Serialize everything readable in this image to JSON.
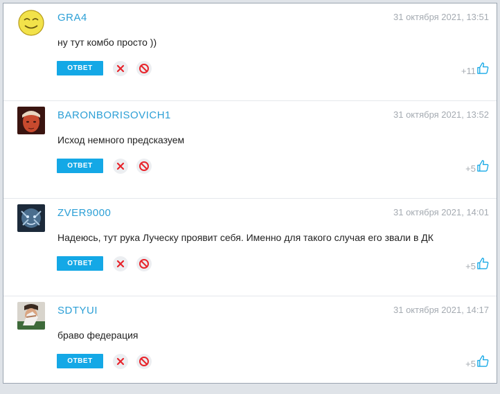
{
  "colors": {
    "accent": "#14a8e6",
    "author": "#2b9fd6",
    "muted": "#a4aab1",
    "delete_red": "#e8242b"
  },
  "comments": [
    {
      "author": "GRA4",
      "date": "31 октября 2021, 13:51",
      "text": "ну тут комбо просто ))",
      "reply_label": "ОТВЕТ",
      "rating": "+11",
      "avatar": "smiley-face-avatar"
    },
    {
      "author": "BARONBORISOVICH1",
      "date": "31 октября 2021, 13:52",
      "text": "Исход немного предсказуем",
      "reply_label": "ОТВЕТ",
      "rating": "+5",
      "avatar": "red-portrait-avatar"
    },
    {
      "author": "ZVER9000",
      "date": "31 октября 2021, 14:01",
      "text": "Надеюсь, тут рука Луческу проявит себя. Именно для такого случая его звали в ДК",
      "reply_label": "ОТВЕТ",
      "rating": "+5",
      "avatar": "blue-beast-avatar"
    },
    {
      "author": "SDTYUI",
      "date": "31 октября 2021, 14:17",
      "text": "браво федерация",
      "reply_label": "ОТВЕТ",
      "rating": "+5",
      "avatar": "facepalm-avatar"
    }
  ]
}
